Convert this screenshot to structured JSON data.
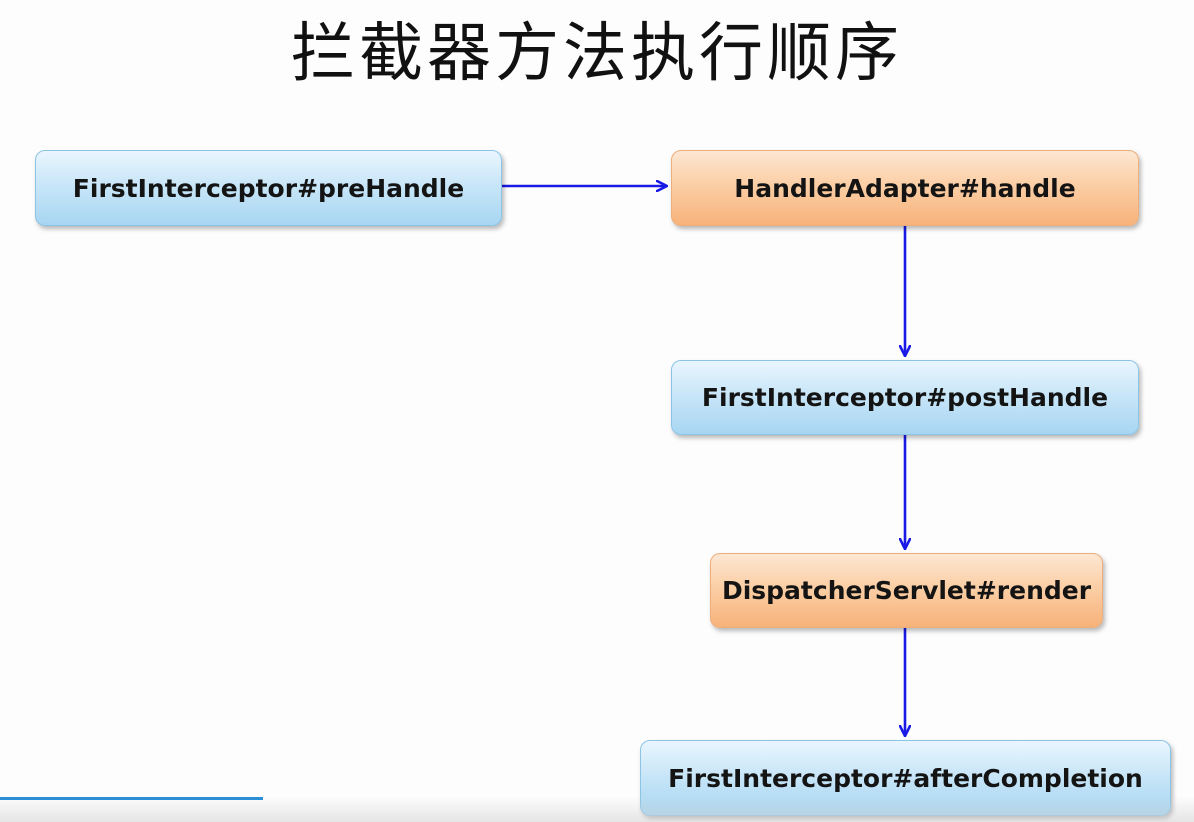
{
  "slide": {
    "title": "拦截器方法执行顺序"
  },
  "nodes": {
    "prehandle": {
      "label": "FirstInterceptor#preHandle",
      "color": "blue"
    },
    "handle": {
      "label": "HandlerAdapter#handle",
      "color": "orange"
    },
    "posthandle": {
      "label": "FirstInterceptor#postHandle",
      "color": "blue"
    },
    "render": {
      "label": "DispatcherServlet#render",
      "color": "orange"
    },
    "after": {
      "label": "FirstInterceptor#afterCompletion",
      "color": "blue"
    }
  },
  "edges": [
    {
      "from": "prehandle",
      "to": "handle"
    },
    {
      "from": "handle",
      "to": "posthandle"
    },
    {
      "from": "posthandle",
      "to": "render"
    },
    {
      "from": "render",
      "to": "after"
    }
  ],
  "colors": {
    "arrow": "#1a1ae6",
    "blue_box": "#b5ddf4",
    "orange_box": "#f9c08f",
    "progress": "#2b8fd6"
  },
  "video": {
    "progress_fraction": 0.22
  }
}
